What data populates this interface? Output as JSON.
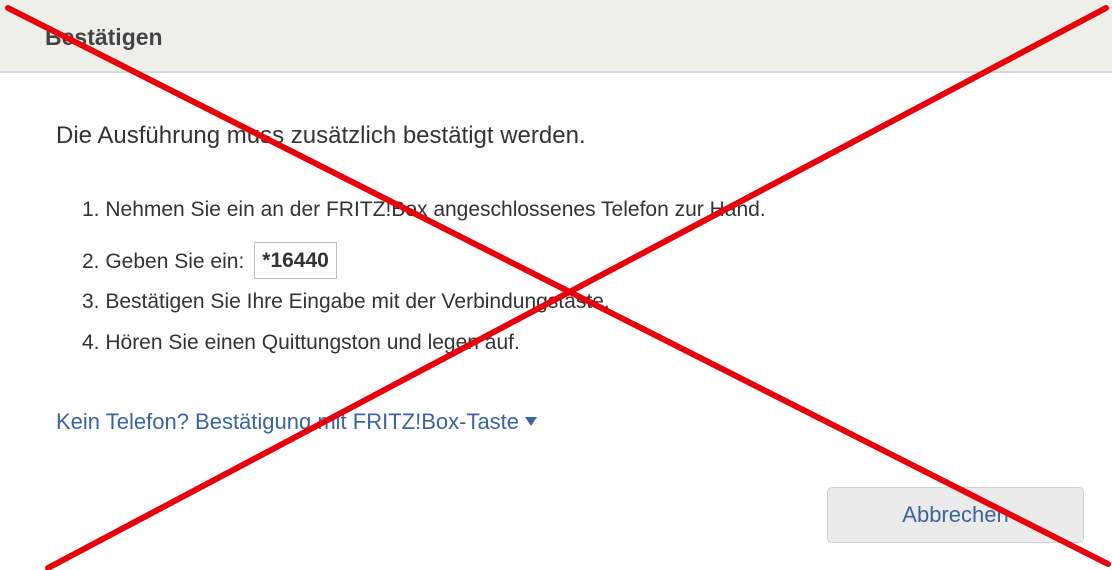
{
  "dialog": {
    "title": "Bestätigen",
    "intro": "Die Ausführung muss zusätzlich bestätigt werden.",
    "steps": [
      "1. Nehmen Sie ein an der FRITZ!Box angeschlossenes Telefon zur Hand.",
      "2. Geben Sie ein:",
      "3. Bestätigen Sie Ihre Eingabe mit der Verbindungstaste.",
      "4. Hören Sie einen Quittungston und legen auf."
    ],
    "code": "*16440",
    "alt_link": "Kein Telefon? Bestätigung mit FRITZ!Box-Taste",
    "cancel_label": "Abbrechen"
  },
  "colors": {
    "header_bg": "#efefea",
    "link": "#3b64a0",
    "cross": "#e8000b",
    "button_bg": "#ebebeb"
  },
  "icons": {
    "expand": "caret-down-icon"
  }
}
